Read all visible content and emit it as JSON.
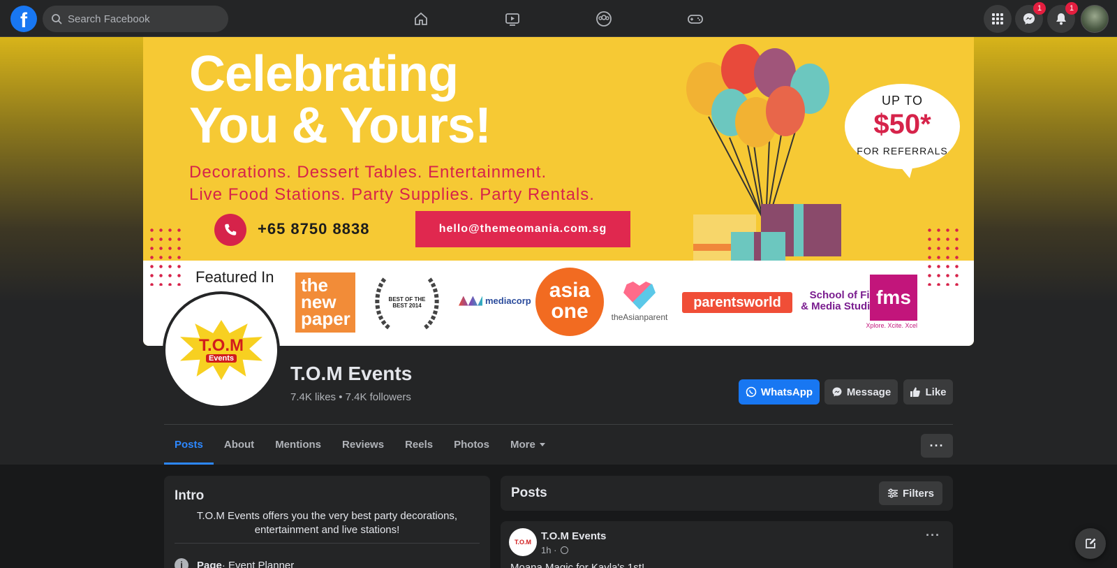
{
  "topnav": {
    "logo_letter": "f",
    "search_placeholder": "Search Facebook",
    "messenger_badge": "1",
    "notifications_badge": "1"
  },
  "cover": {
    "headline_1": "Celebrating",
    "headline_2": "You & Yours!",
    "sub_1": "Decorations. Dessert Tables. Entertainment.",
    "sub_2": "Live Food Stations. Party Supplies. Party Rentals.",
    "phone": "+65 8750 8838",
    "email": "hello@themeomania.com.sg",
    "bubble_1": "UP TO",
    "bubble_2": "$50*",
    "bubble_3": "FOR REFERRALS",
    "featured_label": "Featured In",
    "logos": {
      "newpaper": "the new paper",
      "laurel": "BEST OF THE BEST 2014",
      "mediacorp": "mediacorp",
      "asiaone_1": "asia",
      "asiaone_2": "one",
      "asianparent": "theAsianparent",
      "parentsworld": "parentsworld",
      "sfm_text": "School of Film & Media Studies",
      "sfm_mark": "fms",
      "sfm_tag": "Xplore. Xcite. Xcel"
    }
  },
  "profile": {
    "logo_main": "T.O.M",
    "logo_sub": "Events",
    "name": "T.O.M Events",
    "stats": "7.4K likes • 7.4K followers"
  },
  "actions": {
    "whatsapp": "WhatsApp",
    "message": "Message",
    "like": "Like"
  },
  "tabs": [
    {
      "label": "Posts",
      "active": true
    },
    {
      "label": "About"
    },
    {
      "label": "Mentions"
    },
    {
      "label": "Reviews"
    },
    {
      "label": "Reels"
    },
    {
      "label": "Photos"
    },
    {
      "label": "More"
    }
  ],
  "more_dots": "···",
  "intro": {
    "title": "Intro",
    "description": "T.O.M Events offers you the very best party decorations, entertainment and live stations!",
    "page_type_label": "Page",
    "page_type_value": " · Event Planner"
  },
  "posts": {
    "title": "Posts",
    "filters": "Filters",
    "post": {
      "author": "T.O.M Events",
      "time": "1h ·",
      "text": "Moana Magic for Kayla's 1st!",
      "avatar_text": "T.O.M"
    }
  },
  "colors": {
    "accent": "#1877f2",
    "cover_yellow": "#f6c934",
    "cover_red": "#d6234a",
    "tab_active": "#2d88ff"
  }
}
